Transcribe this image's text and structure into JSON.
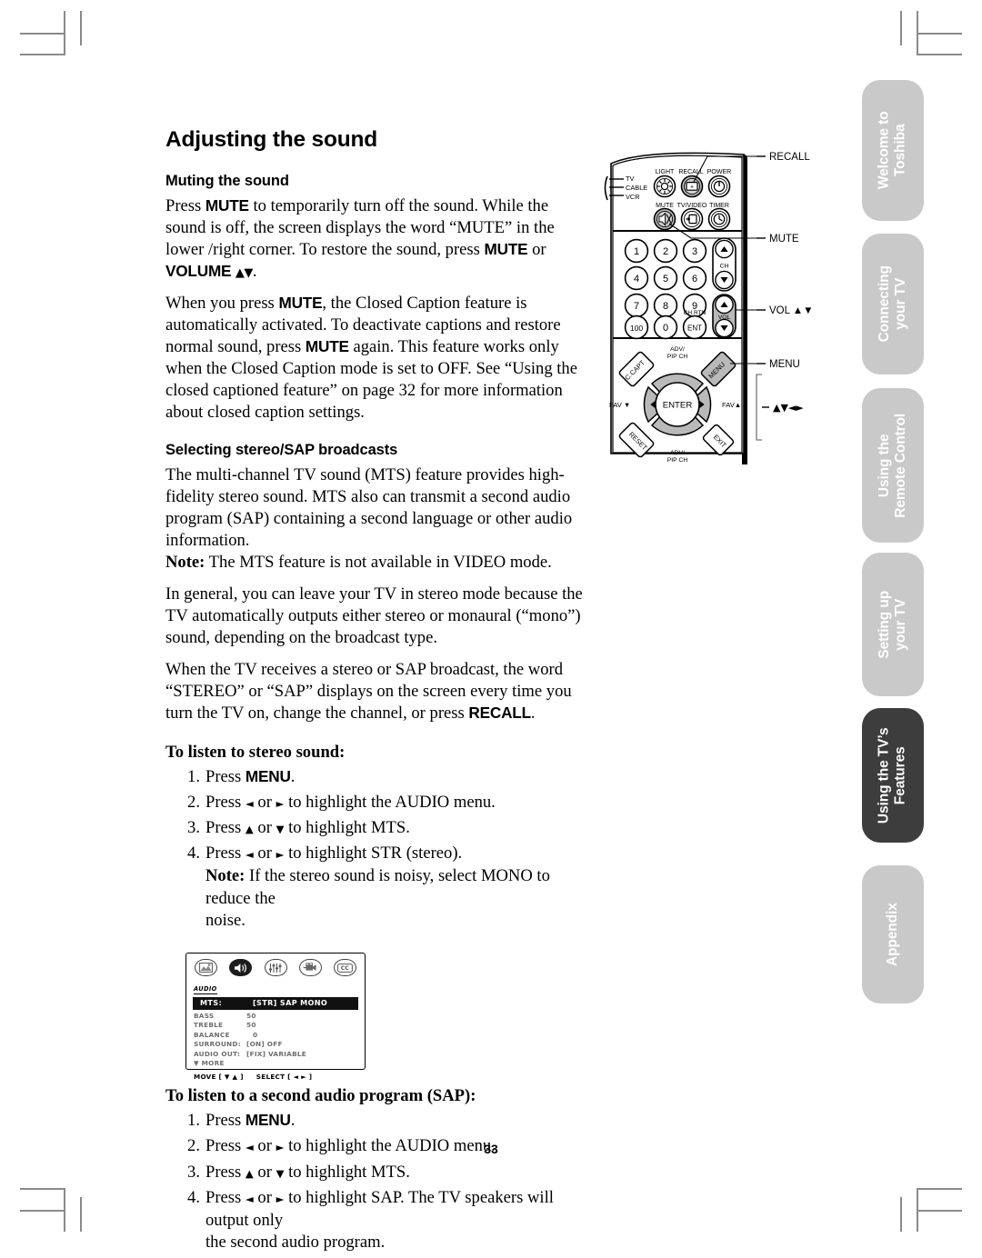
{
  "page": {
    "number": "33",
    "title": "Adjusting the sound"
  },
  "sections": [
    {
      "heading": "Muting the sound",
      "paragraphs": [
        "Press MUTE to temporarily turn off the sound. While the sound is off, the screen displays the word “MUTE” in the lower /right corner. To restore the sound, press MUTE or VOLUME ▲▼.",
        "When you press MUTE, the Closed Caption feature is automatically activated. To deactivate captions and restore normal sound, press MUTE again. This feature works only when the Closed Caption mode is set to OFF. See “Using the closed captioned feature” on page 32 for more information about closed caption settings."
      ]
    },
    {
      "heading": "Selecting stereo/SAP broadcasts",
      "paragraphs": [
        "The multi-channel TV sound (MTS) feature provides high-fidelity stereo sound. MTS also can transmit a second audio program (SAP) containing a second language or other audio information.",
        "Note: The MTS feature is not available in VIDEO mode.",
        "In general, you can leave your TV in stereo mode because the TV automatically outputs either stereo or monaural (“mono”) sound, depending on the broadcast type.",
        "When the TV receives a stereo or SAP broadcast, the word “STEREO” or “SAP” displays on the screen every time you turn the TV on, change the channel, or press RECALL."
      ]
    }
  ],
  "procedures": [
    {
      "heading": "To listen to stereo sound:",
      "steps": [
        "Press MENU.",
        "Press ◄ or ► to highlight the AUDIO menu.",
        "Press ▲ or ▼ to highlight MTS.",
        "Press ◄ or ► to highlight STR (stereo).",
        "Note: If the stereo sound is noisy, select MONO to reduce the noise."
      ]
    },
    {
      "heading": "To listen to a second audio program (SAP):",
      "steps": [
        "Press MENU.",
        "Press ◄ or ► to highlight the AUDIO menu.",
        "Press ▲ or ▼ to highlight MTS.",
        "Press ◄ or ► to highlight SAP. The TV speakers will output only the second audio program."
      ]
    }
  ],
  "audio_menu": {
    "title": "AUDIO",
    "icons": [
      "picture-icon",
      "audio-icon",
      "settings-icon",
      "video-icon",
      "closed-caption-icon"
    ],
    "selected_icon": "audio-icon",
    "rows": [
      {
        "label": "MTS:",
        "value": "[STR] SAP MONO",
        "highlighted": true
      },
      {
        "label": "BASS",
        "value": "50",
        "highlighted": false
      },
      {
        "label": "TREBLE",
        "value": "50",
        "highlighted": false
      },
      {
        "label": "BALANCE",
        "value": "0",
        "highlighted": false
      },
      {
        "label": "SURROUND:",
        "value": "[ON] OFF",
        "highlighted": false
      },
      {
        "label": "AUDIO OUT:",
        "value": "[FIX] VARIABLE",
        "highlighted": false
      },
      {
        "label": "▼ MORE",
        "value": "",
        "highlighted": false
      }
    ],
    "footer": {
      "move": "MOVE [ ▼ ▲ ]",
      "select": "SELECT [ ◄ ► ]"
    }
  },
  "remote": {
    "mode_switch": [
      "TV",
      "CABLE",
      "VCR"
    ],
    "top_buttons": [
      {
        "label": "LIGHT",
        "icon": "light-icon"
      },
      {
        "label": "RECALL",
        "icon": "recall-icon"
      },
      {
        "label": "POWER",
        "icon": "power-icon"
      },
      {
        "label": "MUTE",
        "icon": "mute-icon"
      },
      {
        "label": "TV/VIDEO",
        "icon": "tv-video-icon"
      },
      {
        "label": "TIMER",
        "icon": "timer-icon"
      }
    ],
    "keypad": [
      "1",
      "2",
      "3",
      "4",
      "5",
      "6",
      "7",
      "8",
      "9",
      "100",
      "0",
      "ENT"
    ],
    "keypad_extra_label": "CH RTN",
    "rockers": [
      {
        "label": "CH"
      },
      {
        "label": "VOL"
      }
    ],
    "nav_buttons": {
      "center": "ENTER",
      "top_label": "ADV/\nPIP CH",
      "bottom_label": "ADV/\nPIP CH",
      "left_label": "FAV ▼",
      "right_label": "FAV▲",
      "corner_tl": "C.CAPT",
      "corner_tr": "MENU",
      "corner_bl": "RESET",
      "corner_br": "EXIT"
    },
    "callouts": [
      {
        "label": "RECALL"
      },
      {
        "label": "MUTE"
      },
      {
        "label": "VOL ▲▼"
      },
      {
        "label": "MENU"
      },
      {
        "label": "▲▼◄►"
      }
    ]
  },
  "sidebar": {
    "tabs": [
      {
        "line1": "Welcome to",
        "line2": "Toshiba",
        "active": false
      },
      {
        "line1": "Connecting",
        "line2": "your TV",
        "active": false
      },
      {
        "line1": "Using the",
        "line2": "Remote Control",
        "active": false
      },
      {
        "line1": "Setting up",
        "line2": "your TV",
        "active": false
      },
      {
        "line1": "Using the TV’s",
        "line2": "Features",
        "active": true
      },
      {
        "line1": "Appendix",
        "line2": "",
        "active": false
      }
    ]
  },
  "colors": {
    "tab_inactive": "#c9c9c9",
    "tab_active": "#3d3d3d",
    "text": "#000000",
    "crop_mark": "#8a8a8a"
  }
}
